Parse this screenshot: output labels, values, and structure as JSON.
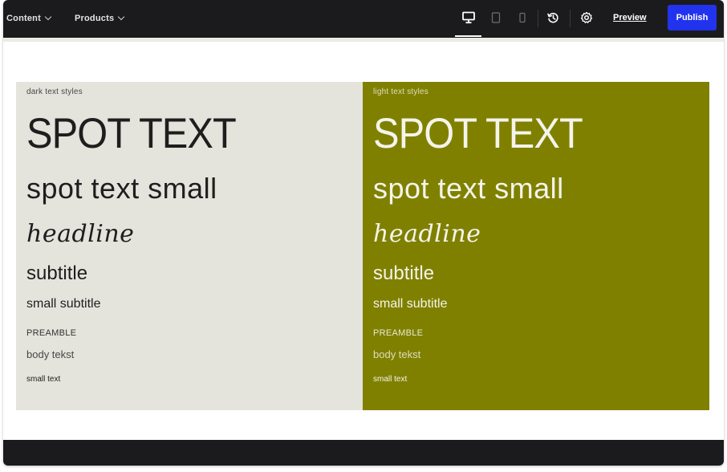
{
  "topbar": {
    "menus": [
      {
        "label": "Content"
      },
      {
        "label": "Products"
      }
    ],
    "devices": [
      "desktop-icon",
      "tablet-icon",
      "mobile-icon"
    ],
    "history_icon": "history-icon",
    "settings_icon": "gear-icon",
    "preview_label": "Preview",
    "publish_label": "Publish",
    "colors": {
      "bar": "#1b1b1d",
      "publish": "#2233ee"
    }
  },
  "panels": {
    "dark": {
      "caption": "dark text styles",
      "spot": "SPOT TEXT",
      "spot_small": "spot text small",
      "headline": "headline",
      "subtitle": "subtitle",
      "small_subtitle": "small subtitle",
      "preamble": "PREAMBLE",
      "body": "body tekst",
      "small": "small text",
      "bg": "#e4e3dc"
    },
    "light": {
      "caption": "light text styles",
      "spot": "SPOT TEXT",
      "spot_small": "spot text small",
      "headline": "headline",
      "subtitle": "subtitle",
      "small_subtitle": "small subtitle",
      "preamble": "PREAMBLE",
      "body": "body tekst",
      "small": "small text",
      "bg": "#808000"
    }
  }
}
